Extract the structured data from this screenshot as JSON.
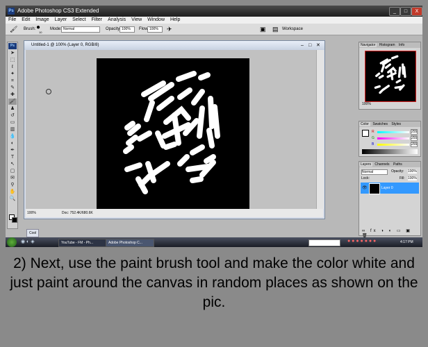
{
  "app": {
    "title": "Adobe Photoshop CS3 Extended",
    "logo": "Ps",
    "window_buttons": [
      "_",
      "□",
      "X"
    ]
  },
  "menu": [
    "File",
    "Edit",
    "Image",
    "Layer",
    "Select",
    "Filter",
    "Analysis",
    "View",
    "Window",
    "Help"
  ],
  "options_bar": {
    "brush_label": "Brush:",
    "brush_size": "10",
    "mode_label": "Mode:",
    "mode_value": "Normal",
    "opacity_label": "Opacity:",
    "opacity_value": "100%",
    "flow_label": "Flow:",
    "flow_value": "100%",
    "workspace_label": "Workspace"
  },
  "document": {
    "title": "Untitled-1 @ 100% (Layer 0, RGB/8)",
    "zoom": "100%",
    "doc_info": "Doc: 752.4K/680.6K"
  },
  "navigator": {
    "tabs": [
      "Navigator",
      "Histogram",
      "Info"
    ],
    "zoom": "100%"
  },
  "color_panel": {
    "tabs": [
      "Color",
      "Swatches",
      "Styles"
    ],
    "channels": [
      {
        "label": "R",
        "value": "255",
        "color": "#ff4040"
      },
      {
        "label": "G",
        "value": "255",
        "color": "#40c040"
      },
      {
        "label": "B",
        "value": "255",
        "color": "#4060ff"
      }
    ]
  },
  "layers_panel": {
    "tabs": [
      "Layers",
      "Channels",
      "Paths"
    ],
    "blend_mode": "Normal",
    "opacity_label": "Opacity:",
    "opacity_value": "100%",
    "lock_label": "Lock:",
    "fill_label": "Fill:",
    "fill_value": "100%",
    "layer_name": "Layer 0"
  },
  "mini_docs": [
    "Cool",
    "",
    ""
  ],
  "taskbar": {
    "tasks": [
      "YouTube - FM - Ph...",
      "Adobe Photoshop C..."
    ],
    "time": "4:17 PM"
  },
  "caption": "2) Next, use the paint brush tool and make the color white and just paint around the canvas in random places as shown on the pic.",
  "colors": {
    "accent": "#3399ff",
    "canvas": "#000000",
    "stroke": "#ffffff"
  }
}
